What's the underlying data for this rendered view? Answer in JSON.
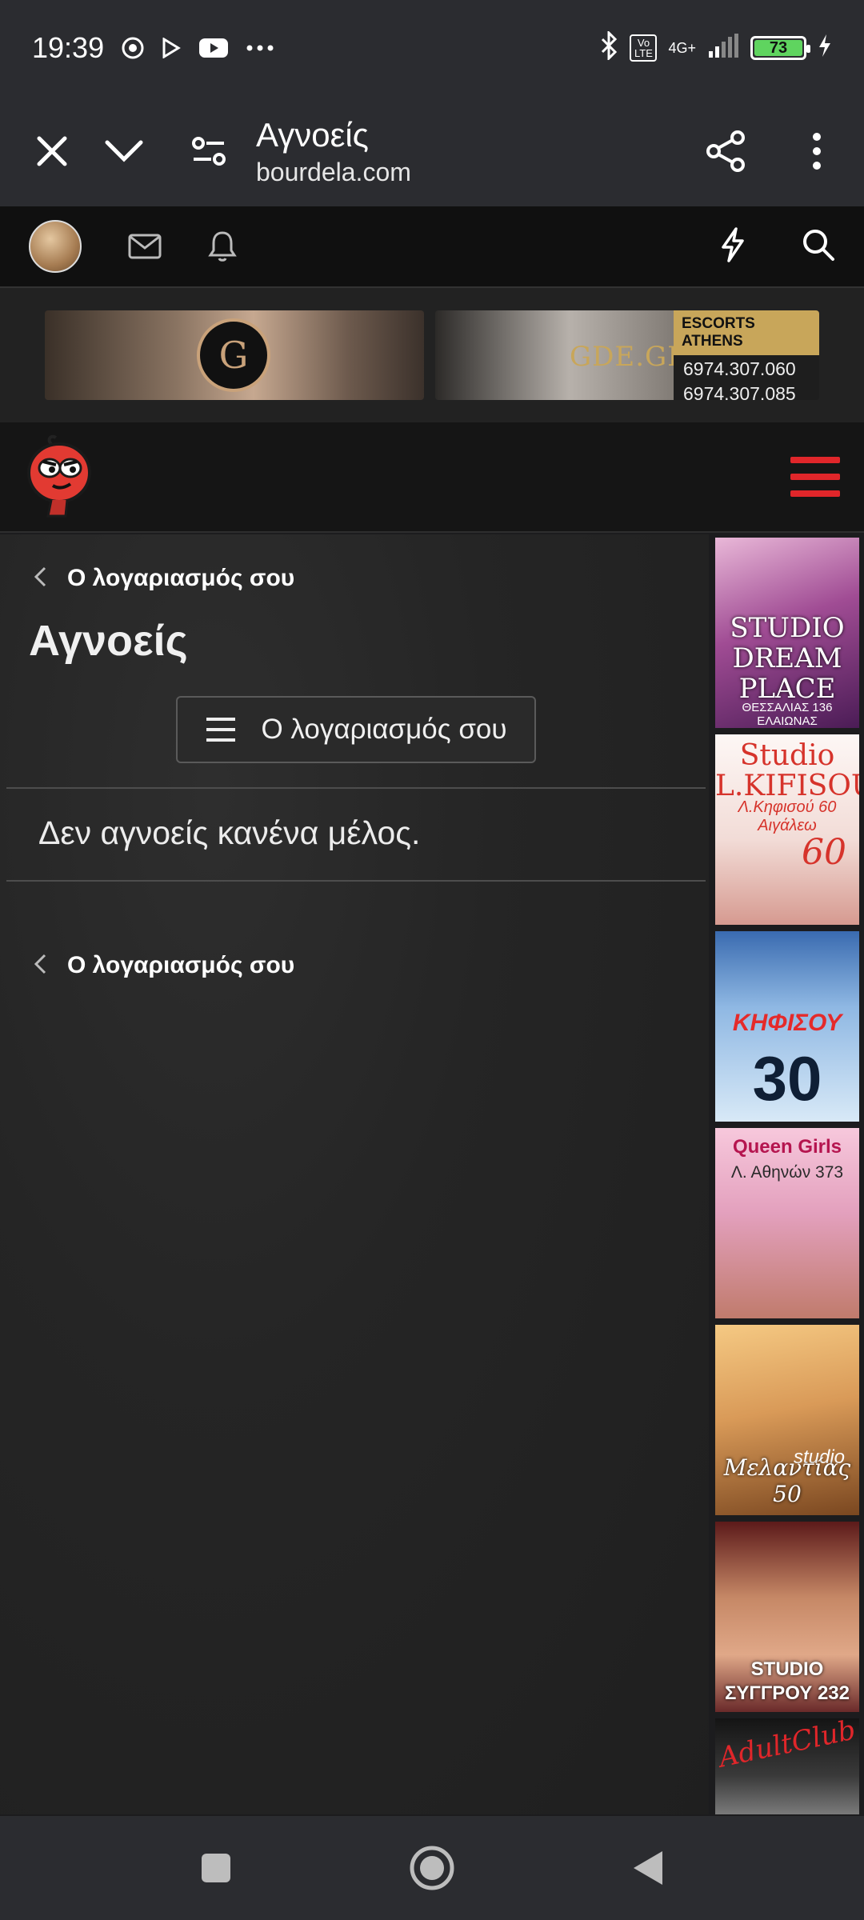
{
  "status_bar": {
    "time": "19:39",
    "signal_label": "4G+",
    "volte_label": "Vo LTE",
    "battery_level": "73"
  },
  "browser": {
    "title": "Αγνοείς",
    "url": "bourdela.com"
  },
  "top_banners": {
    "banner_1_logo": "G",
    "banner_2_brand": "GDE.GR",
    "banner_2_title": "ESCORTS ATHENS",
    "banner_2_phones": [
      "6974.307.060",
      "6974.307.085"
    ]
  },
  "content": {
    "breadcrumb_top": "Ο λογαριασμός σου",
    "page_title": "Αγνοείς",
    "account_button": "Ο λογαριασμός σου",
    "empty_message": "Δεν αγνοείς κανένα μέλος.",
    "breadcrumb_bottom": "Ο λογαριασμός σου"
  },
  "side_ads": {
    "ad_1_title": "STUDIO DREAM PLACE",
    "ad_1_address": "ΘΕΣΣΑΛΙΑΣ 136 ΕΛΑΙΩΝΑΣ",
    "ad_2_title": "Studio L.KIFISOU",
    "ad_2_address": "Λ.Κηφισού 60 Αιγάλεω",
    "ad_2_number": "60",
    "ad_3_title": "ΚΗΦΙΣΟΥ",
    "ad_3_number": "30",
    "ad_4_title": "Queen Girls",
    "ad_4_address": "Λ. Αθηνών 373",
    "ad_5_studio": "studio",
    "ad_5_title": "Μελαντίας 50",
    "ad_6_title": "STUDIO ΣΥΓΓΡΟΥ 232",
    "ad_7_title": "AdultClub"
  },
  "colors": {
    "accent_red": "#e0262a",
    "toolbar_bg": "#2b2c30",
    "battery_green": "#5fd45f"
  }
}
